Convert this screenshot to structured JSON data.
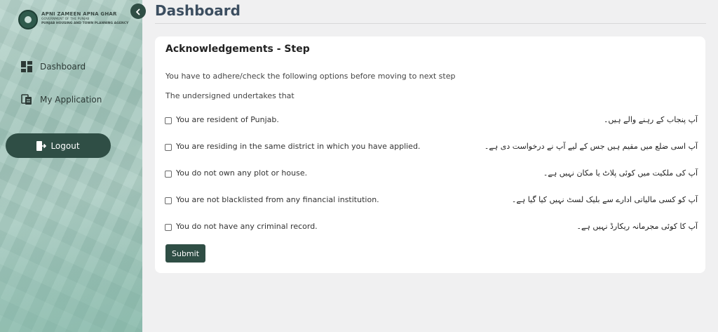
{
  "sidebar": {
    "logo": {
      "title": "APNI ZAMEEN APNA GHAR",
      "subtitle": "GOVERNMENT OF THE PUNJAB",
      "agency": "PUNJAB HOUSING AND TOWN PLANNING AGENCY"
    },
    "items": [
      {
        "label": "Dashboard",
        "icon": "dashboard-grid-icon"
      },
      {
        "label": "My Application",
        "icon": "application-document-icon"
      }
    ],
    "logout_label": "Logout",
    "logout_icon": "logout-icon",
    "collapse_icon": "chevron-left-icon"
  },
  "header": {
    "title": "Dashboard"
  },
  "card": {
    "title": "Acknowledgements - Step",
    "intro": "You have to adhere/check the following options before moving to next step",
    "undertaking": "The undersigned undertakes that",
    "items": [
      {
        "en": "You are resident of Punjab.",
        "ur": "آپ پنجاب کے رہنے والے ہیں۔",
        "checked": false
      },
      {
        "en": "You are residing in the same district in which you have applied.",
        "ur": "آپ اسی ضلع میں مقیم ہیں جس کے لیے آپ نے درخواست دی ہے۔",
        "checked": false
      },
      {
        "en": "You do not own any plot or house.",
        "ur": "آپ کی ملکیت میں کوئی پلاٹ یا مکان نہیں ہے۔",
        "checked": false
      },
      {
        "en": "You are not blacklisted from any financial institution.",
        "ur": "آپ کو کسی مالیاتی ادارے سے بلیک لسٹ نہیں کیا گیا ہے۔",
        "checked": false
      },
      {
        "en": "You do not have any criminal record.",
        "ur": "آپ کا کوئی مجرمانہ ریکارڈ نہیں ہے۔",
        "checked": false
      }
    ],
    "submit_label": "Submit"
  },
  "colors": {
    "primary": "#2f4e45",
    "title": "#3c4e60",
    "background": "#f0f0f1"
  }
}
